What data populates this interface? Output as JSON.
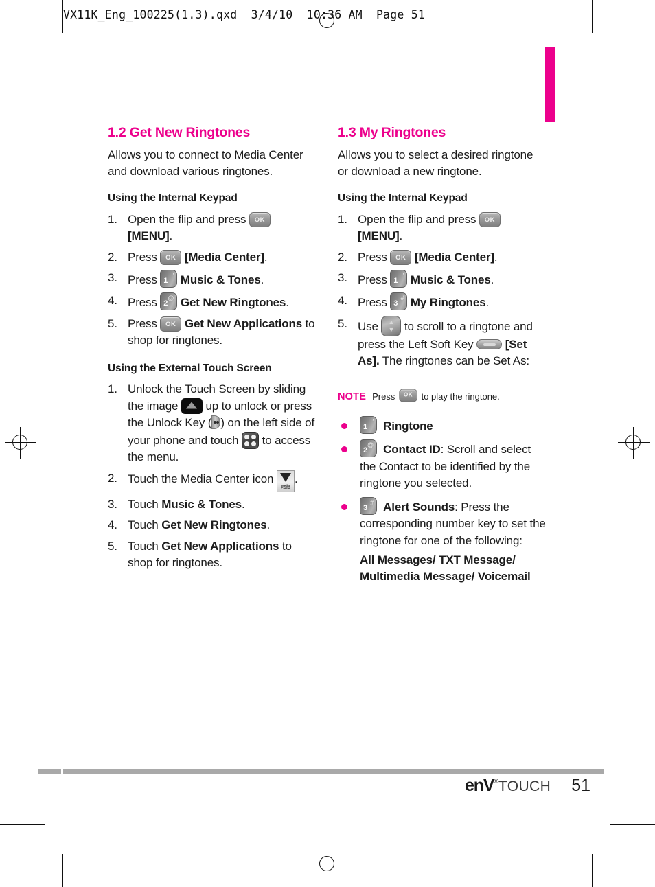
{
  "slug": {
    "text": "VX11K_Eng_100225(1.3).qxd  3/4/10  10:36 AM  Page 51"
  },
  "colors": {
    "accent": "#ec008c",
    "body_text": "#1c1c1c",
    "rule_gray": "#a9a9a9"
  },
  "left_column": {
    "heading": "1.2 Get New Ringtones",
    "intro": "Allows you to connect to Media Center and download various ringtones.",
    "subheading_internal": "Using the Internal Keypad",
    "internal_steps": [
      {
        "num": "1.",
        "pre": "Open the flip and press",
        "key": "ok-key",
        "bold": "[MENU]",
        "post": "."
      },
      {
        "num": "2.",
        "pre": "Press",
        "key": "ok-key",
        "bold": "[Media Center]",
        "post": "."
      },
      {
        "num": "3.",
        "pre": "Press",
        "key": "num1-key",
        "bold": "Music & Tones",
        "post": "."
      },
      {
        "num": "4.",
        "pre": "Press",
        "key": "num2-key",
        "bold": "Get New Ringtones",
        "post": "."
      },
      {
        "num": "5.",
        "pre": "Press",
        "key": "ok-key",
        "bold": "Get New Applications",
        "post": " to shop for ringtones."
      }
    ],
    "subheading_external": "Using the External Touch Screen",
    "external_steps": [
      {
        "num": "1.",
        "t1": "Unlock the Touch Screen by sliding the image",
        "t2": "up to unlock or press the Unlock Key (",
        "t3": ") on the left side of your phone and touch",
        "t4": "to access the menu."
      },
      {
        "num": "2.",
        "pre": "Touch the Media Center icon",
        "post": "."
      },
      {
        "num": "3.",
        "pre": "Touch",
        "bold": "Music & Tones",
        "post": "."
      },
      {
        "num": "4.",
        "pre": "Touch",
        "bold": "Get New Ringtones",
        "post": "."
      },
      {
        "num": "5.",
        "pre": "Touch",
        "bold": "Get New Applications",
        "post": " to shop for ringtones."
      }
    ]
  },
  "right_column": {
    "heading": "1.3 My Ringtones",
    "intro": "Allows you to select a desired ringtone or download a new ringtone.",
    "subheading_internal": "Using the Internal Keypad",
    "internal_steps": [
      {
        "num": "1.",
        "pre": "Open the flip and press",
        "key": "ok-key",
        "bold": "[MENU]",
        "post": "."
      },
      {
        "num": "2.",
        "pre": "Press",
        "key": "ok-key",
        "bold": "[Media Center]",
        "post": "."
      },
      {
        "num": "3.",
        "pre": "Press",
        "key": "num1-key",
        "bold": "Music & Tones",
        "post": "."
      },
      {
        "num": "4.",
        "pre": "Press",
        "key": "num3-key",
        "bold": "My Ringtones",
        "post": "."
      },
      {
        "num": "5.",
        "pre": "Use",
        "mid": "to scroll to a ringtone and press the Left Soft Key",
        "bold": "[Set As].",
        "post": " The ringtones can be Set As:"
      }
    ],
    "note": {
      "label": "NOTE",
      "pre": "Press",
      "post": "to play the ringtone."
    },
    "bullets": [
      {
        "key": "num1-key",
        "bold": "Ringtone",
        "rest": ""
      },
      {
        "key": "num2-key",
        "bold": "Contact ID",
        "rest": ": Scroll and select the Contact to be identified by the ringtone you selected."
      },
      {
        "key": "num3-key",
        "bold": "Alert Sounds",
        "rest": ": Press the corresponding number key to set the ringtone for one of the following:"
      }
    ],
    "alert_options": "All Messages/ TXT Message/ Multimedia Message/ Voicemail"
  },
  "keys": {
    "ok_label": "OK",
    "num1_digit": "1",
    "num1_symbol": "′",
    "num2_digit": "2",
    "num2_symbol": "@",
    "num3_digit": "3",
    "num3_symbol": "#",
    "scroll_up": "▲",
    "scroll_down": "▼"
  },
  "media_center_icon": {
    "line1": "Media",
    "line2": "Center"
  },
  "footer": {
    "logo_main": "enV",
    "logo_reg": "®",
    "logo_sub": "TOUCH",
    "page_number": "51"
  }
}
